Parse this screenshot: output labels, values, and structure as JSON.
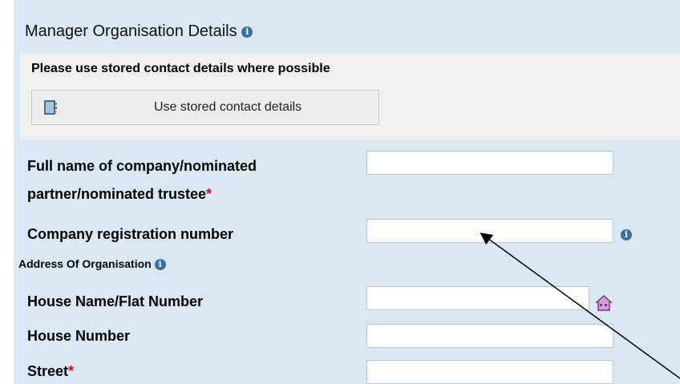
{
  "section": {
    "title": "Manager Organisation Details",
    "info_icon": "info-icon"
  },
  "notice": {
    "text": "Please use stored contact details where possible",
    "button_label": "Use stored contact details",
    "button_icon": "contact-book-icon"
  },
  "fields": [
    {
      "label_line1": "Full name of company/nominated",
      "label_line2": "partner/nominated trustee",
      "required": true,
      "value": ""
    },
    {
      "label": "Company registration number",
      "required": false,
      "value": "",
      "info_icon": "info-icon"
    },
    {
      "subheading": "Address Of Organisation",
      "info_icon": "info-icon"
    },
    {
      "label": "House Name/Flat Number",
      "required": false,
      "value": "",
      "lookup_icon": "house-lookup-icon"
    },
    {
      "label": "House Number",
      "required": false,
      "value": ""
    },
    {
      "label": "Street",
      "required": true,
      "value": ""
    }
  ],
  "required_marker": "*",
  "colors": {
    "panel_bg": "#dbe8f1",
    "required": "#e0001b",
    "info_icon": "#3b6fa8",
    "house_icon": "#8b2d8b"
  }
}
